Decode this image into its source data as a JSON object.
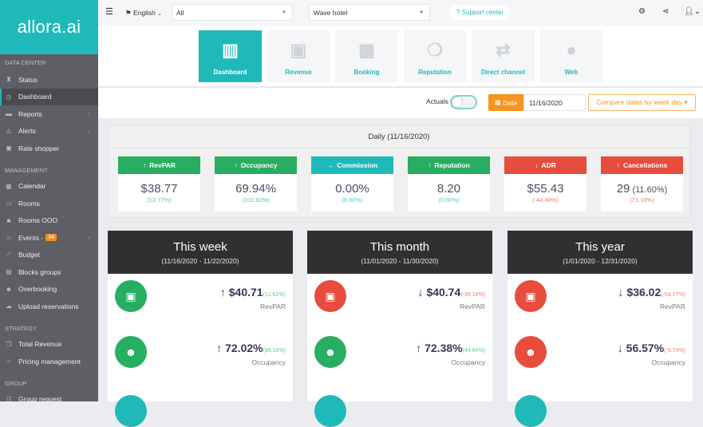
{
  "colors": {
    "teal": "#1fb9b9",
    "green": "#27ae60",
    "red": "#e74c3c",
    "orange": "#f7941d",
    "dark": "#303030"
  },
  "sidebar": {
    "logo": "allora.ai",
    "sections": [
      {
        "label": "DATA CENTER",
        "items": [
          {
            "label": "Status",
            "icon": "binoculars-icon"
          },
          {
            "label": "Dashboard",
            "icon": "dashboard-icon",
            "active": true
          },
          {
            "label": "Reports",
            "icon": "folder-icon",
            "chevron": true
          },
          {
            "label": "Alerts",
            "icon": "warning-icon",
            "chevron": true
          },
          {
            "label": "Rate shopper",
            "icon": "money-icon"
          }
        ]
      },
      {
        "label": "MANAGEMENT",
        "items": [
          {
            "label": "Calendar",
            "icon": "calendar-icon"
          },
          {
            "label": "Rooms",
            "icon": "bed-icon"
          },
          {
            "label": "Rooms OOO",
            "icon": "lock-icon"
          },
          {
            "label": "Events -",
            "icon": "ticket-icon",
            "badge": "34",
            "chevron": true
          },
          {
            "label": "Budget",
            "icon": "chart-icon"
          },
          {
            "label": "Blocks groups",
            "icon": "list-icon"
          },
          {
            "label": "Overbooking",
            "icon": "users-icon"
          },
          {
            "label": "Upload reservations",
            "icon": "cloud-upload-icon"
          }
        ]
      },
      {
        "label": "STRATEGY",
        "items": [
          {
            "label": "Total Revenue",
            "icon": "copy-icon"
          },
          {
            "label": "Pricing management",
            "icon": "circle-icon"
          }
        ]
      },
      {
        "label": "GROUP",
        "items": [
          {
            "label": "Group request",
            "icon": "group-icon"
          }
        ]
      }
    ]
  },
  "topbar": {
    "language": "English",
    "filter1": "All",
    "hotel": "Wave hotel",
    "support": "? Support center"
  },
  "tabs": [
    {
      "label": "Dashboard",
      "icon": "bar-chart-icon",
      "active": true
    },
    {
      "label": "Revenue",
      "icon": "money-icon"
    },
    {
      "label": "Booking",
      "icon": "archive-icon"
    },
    {
      "label": "Reputation",
      "icon": "comments-icon"
    },
    {
      "label": "Direct channel",
      "icon": "exchange-icon"
    },
    {
      "label": "Web",
      "icon": "globe-icon"
    }
  ],
  "controls": {
    "actuals": "Actuals",
    "date_label": "Date",
    "date": "11/16/2020",
    "compare": "Compare dates by week day ▾"
  },
  "daily": {
    "title": "Daily (11/16/2020)",
    "kpis": [
      {
        "label": "RevPAR",
        "arrow": "↑",
        "value": "$38.77",
        "extra": "",
        "change": "(12.77%)",
        "color": "#27ae60",
        "cchange": "#5fc98a"
      },
      {
        "label": "Occupancy",
        "arrow": "↑",
        "value": "69.94%",
        "extra": "",
        "change": "(102.82%)",
        "color": "#27ae60",
        "cchange": "#5fc98a"
      },
      {
        "label": "Commission",
        "arrow": "→",
        "value": "0.00%",
        "extra": "",
        "change": "(0.00%)",
        "color": "#1fb9b9",
        "cchange": "#4cc9c9"
      },
      {
        "label": "Reputation",
        "arrow": "↑",
        "value": "8.20",
        "extra": "",
        "change": "(0.00%)",
        "color": "#27ae60",
        "cchange": "#4cc9c9"
      },
      {
        "label": "ADR",
        "arrow": "↓",
        "value": "$55.43",
        "extra": "",
        "change": "(-44.40%)",
        "color": "#e74c3c",
        "cchange": "#ef7a6e"
      },
      {
        "label": "Cancellations",
        "arrow": "↑",
        "value": "29",
        "extra": " (11.60%)",
        "change": "(71.10%)",
        "color": "#e74c3c",
        "cchange": "#ef7a6e"
      }
    ]
  },
  "periods": [
    {
      "title": "This week",
      "range": "(11/16/2020 - 11/22/2020)",
      "rows": [
        {
          "arrow": "↑",
          "value": "$40.71",
          "change": "(12.62%)",
          "label": "RevPAR",
          "color": "#27ae60",
          "icon": "money-icon"
        },
        {
          "arrow": "↑",
          "value": "72.02%",
          "change": "(96.18%)",
          "label": "Occupancy",
          "color": "#27ae60",
          "icon": "users-icon"
        }
      ]
    },
    {
      "title": "This month",
      "range": "(11/01/2020 - 11/30/2020)",
      "rows": [
        {
          "arrow": "↓",
          "value": "$40.74",
          "change": "(-39.16%)",
          "label": "RevPAR",
          "color": "#e74c3c",
          "icon": "money-icon"
        },
        {
          "arrow": "↑",
          "value": "72.38%",
          "change": "(44.64%)",
          "label": "Occupancy",
          "color": "#27ae60",
          "icon": "users-icon"
        }
      ]
    },
    {
      "title": "This year",
      "range": "(1/01/2020 - 12/31/2020)",
      "rows": [
        {
          "arrow": "↓",
          "value": "$36.02",
          "change": "(-54.77%)",
          "label": "RevPAR",
          "color": "#e74c3c",
          "icon": "money-icon"
        },
        {
          "arrow": "↓",
          "value": "56.57%",
          "change": "(-5.74%)",
          "label": "Occupancy",
          "color": "#e74c3c",
          "icon": "users-icon"
        }
      ]
    }
  ]
}
